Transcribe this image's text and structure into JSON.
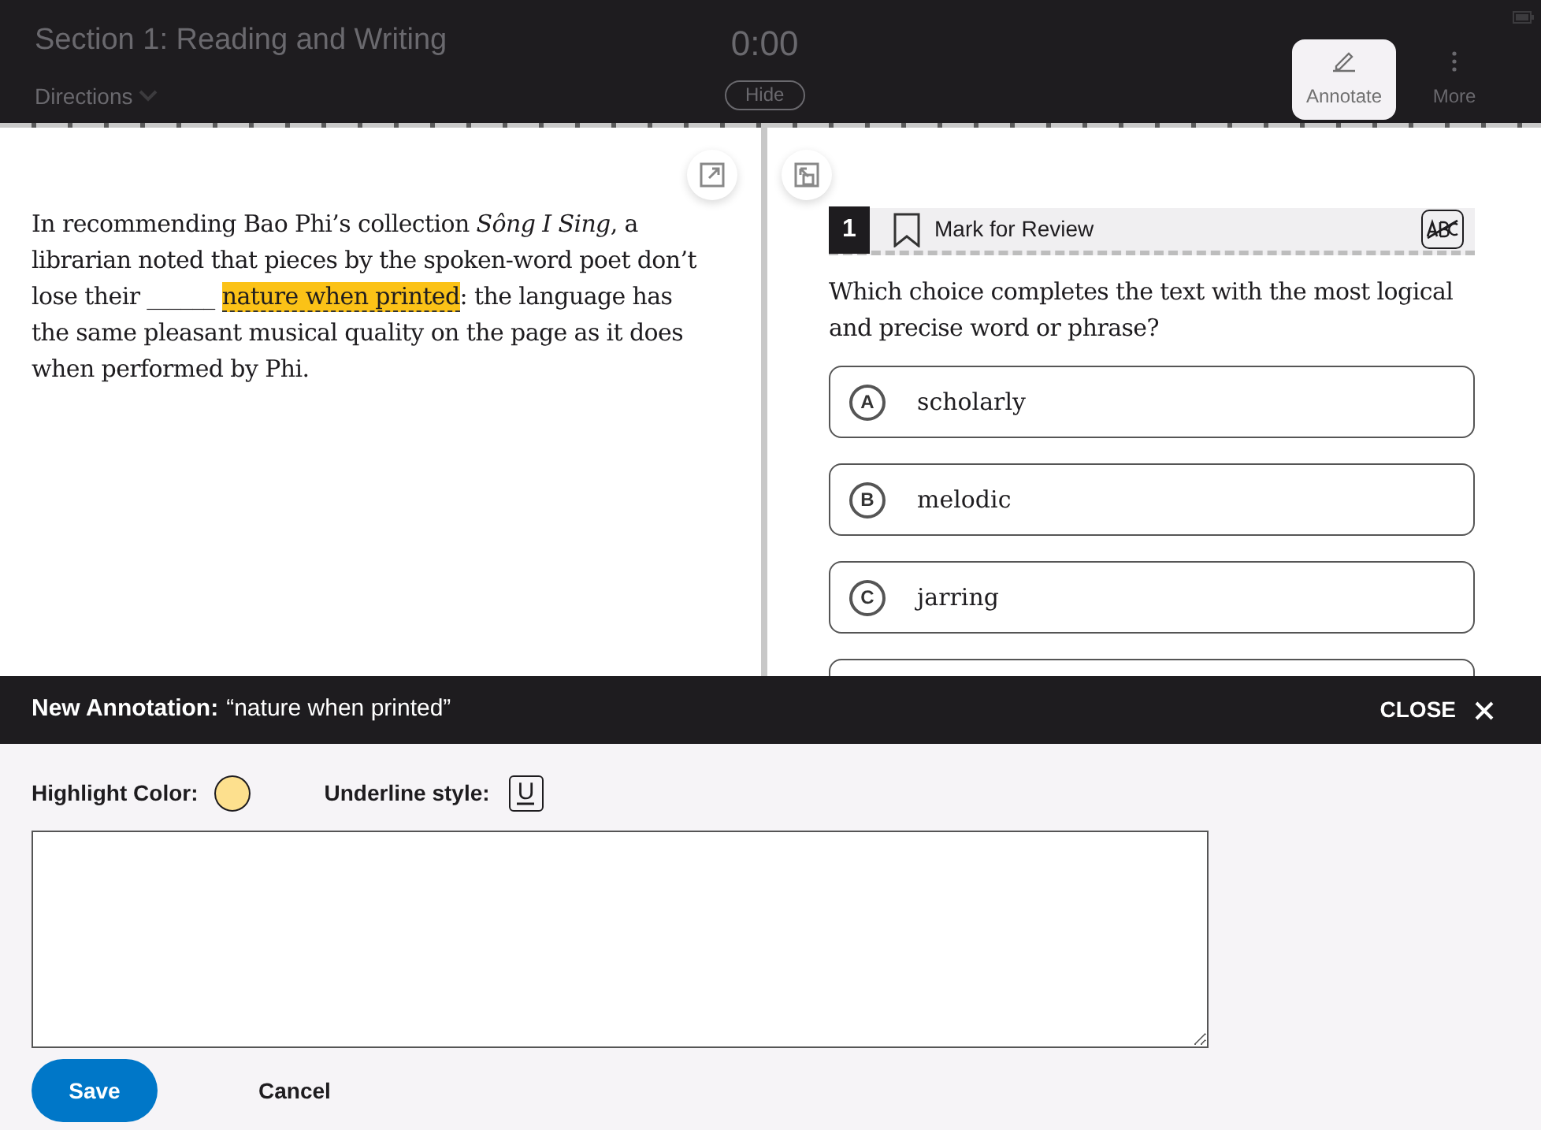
{
  "header": {
    "section_title": "Section 1: Reading and Writing",
    "directions": "Directions",
    "timer": "0:00",
    "hide_button": "Hide",
    "tools": [
      {
        "label": "Annotate",
        "kind": "annotate",
        "selected": true
      },
      {
        "label": "More",
        "kind": "more",
        "selected": false
      }
    ]
  },
  "passage": {
    "before": "In recommending Bao Phi’s collection *Sông I Sing*, a librarian noted that pieces by the spoken-word poet don’t lose their ______ ",
    "highlight": "nature when printed",
    "after": ": the language has the same pleasant musical quality on the page as it does when performed by Phi."
  },
  "question": {
    "number": "1",
    "mark_for_review": "Mark for Review",
    "marked": false,
    "prompt": "Which choice completes the text with the most logical and precise word or phrase?",
    "choices": [
      {
        "letter": "A",
        "text": "scholarly",
        "selected": false
      },
      {
        "letter": "B",
        "text": "melodic",
        "selected": false
      },
      {
        "letter": "C",
        "text": "jarring",
        "selected": false
      }
    ]
  },
  "annotation": {
    "title": "New Annotation:",
    "quote": "“nature when printed”",
    "close": "CLOSE",
    "highlight_label": "Highlight Color:",
    "highlight_swatch": {
      "color": "#fde08e"
    },
    "underline_label": "Underline style:",
    "underline_glyph": "U",
    "save": "Save",
    "cancel": "Cancel"
  }
}
